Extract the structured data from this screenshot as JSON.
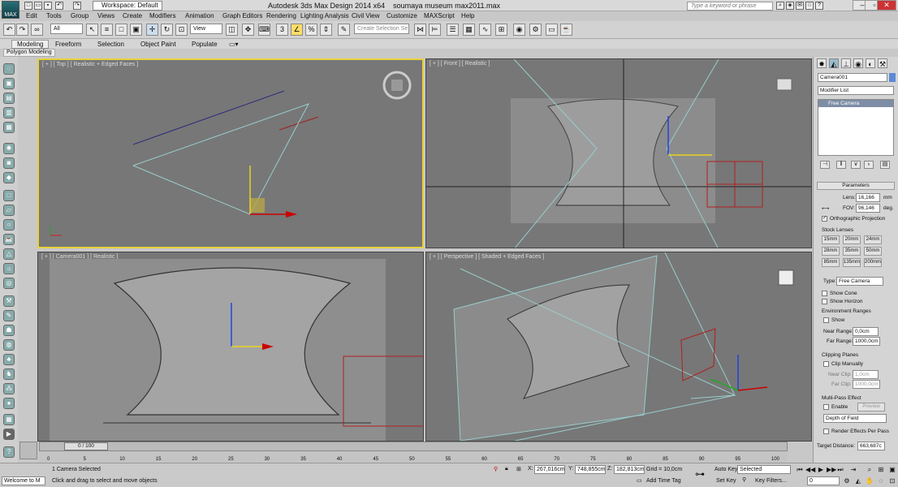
{
  "app": {
    "logo": "MAX",
    "workspace": "Workspace: Default",
    "title_left": "Autodesk 3ds Max Design 2014 x64",
    "title_right": "soumaya museum max2011.max",
    "search_placeholder": "Type a keyword or phrase"
  },
  "menu": [
    "Edit",
    "Tools",
    "Group",
    "Views",
    "Create",
    "Modifiers",
    "Animation",
    "Graph Editors",
    "Rendering",
    "Lighting Analysis",
    "Civil View",
    "Customize",
    "MAXScript",
    "Help"
  ],
  "toolbar": {
    "filter": "All",
    "ref_coord": "View",
    "selection_set_placeholder": "Create Selection Se"
  },
  "ribbon": {
    "tabs": [
      "Modeling",
      "Freeform",
      "Selection",
      "Object Paint",
      "Populate"
    ],
    "active_tab": "Modeling",
    "panel": "Polygon Modeling"
  },
  "viewports": {
    "top": "[ + ] [ Top ] [ Realistic + Edged Faces ]",
    "front": "[ + ] [ Front ] [ Realistic ]",
    "camera": "[ + ] [ Camera001 ] [ Realistic ]",
    "perspective": "[ + ] [ Perspective ] [ Shaded + Edged Faces ]"
  },
  "command_panel": {
    "object_name": "Camera001",
    "modifier_list": "Modifier List",
    "stack_item": "Free Camera",
    "rollout_title": "Parameters",
    "lens_label": "Lens:",
    "lens_value": "16,166",
    "lens_unit": "mm",
    "fov_label": "FOV:",
    "fov_value": "96,146",
    "fov_unit": "deg.",
    "ortho": "Orthographic Projection",
    "stock_lenses": "Stock Lenses",
    "lenses": [
      "15mm",
      "20mm",
      "24mm",
      "28mm",
      "35mm",
      "50mm",
      "85mm",
      "135mm",
      "200mm"
    ],
    "type_label": "Type:",
    "type_value": "Free Camera",
    "show_cone": "Show Cone",
    "show_horizon": "Show Horizon",
    "env_ranges": "Environment Ranges",
    "show": "Show",
    "near_range_label": "Near Range:",
    "near_range": "0,0cm",
    "far_range_label": "Far Range:",
    "far_range": "1000,0cm",
    "clipping": "Clipping Planes",
    "clip_manually": "Clip Manually",
    "near_clip_label": "Near Clip:",
    "near_clip": "1,0cm",
    "far_clip_label": "Far Clip:",
    "far_clip": "1000,0cm",
    "multipass": "Multi-Pass Effect",
    "enable": "Enable",
    "preview": "Preview",
    "effect": "Depth of Field",
    "render_effects": "Render Effects Per Pass",
    "target_distance_label": "Target Distance:",
    "target_distance": "663,687c"
  },
  "timeline": {
    "frame": "0 / 100",
    "ticks": [
      "0",
      "5",
      "10",
      "15",
      "20",
      "25",
      "30",
      "35",
      "40",
      "45",
      "50",
      "55",
      "60",
      "65",
      "70",
      "75",
      "80",
      "85",
      "90",
      "95",
      "100"
    ]
  },
  "status": {
    "maxscript": "Welcome to M",
    "selected": "1 Camera Selected",
    "prompt": "Click and drag to select and move objects",
    "x_label": "X:",
    "x": "267,016cm",
    "y_label": "Y:",
    "y": "748,855cm",
    "z_label": "Z:",
    "z": "182,813cm",
    "grid": "Grid = 10,0cm",
    "add_time_tag": "Add Time Tag",
    "auto_key": "Auto Key",
    "set_key": "Set Key",
    "key_mode": "Selected",
    "key_filters": "Key Filters...",
    "current_frame": "0"
  }
}
